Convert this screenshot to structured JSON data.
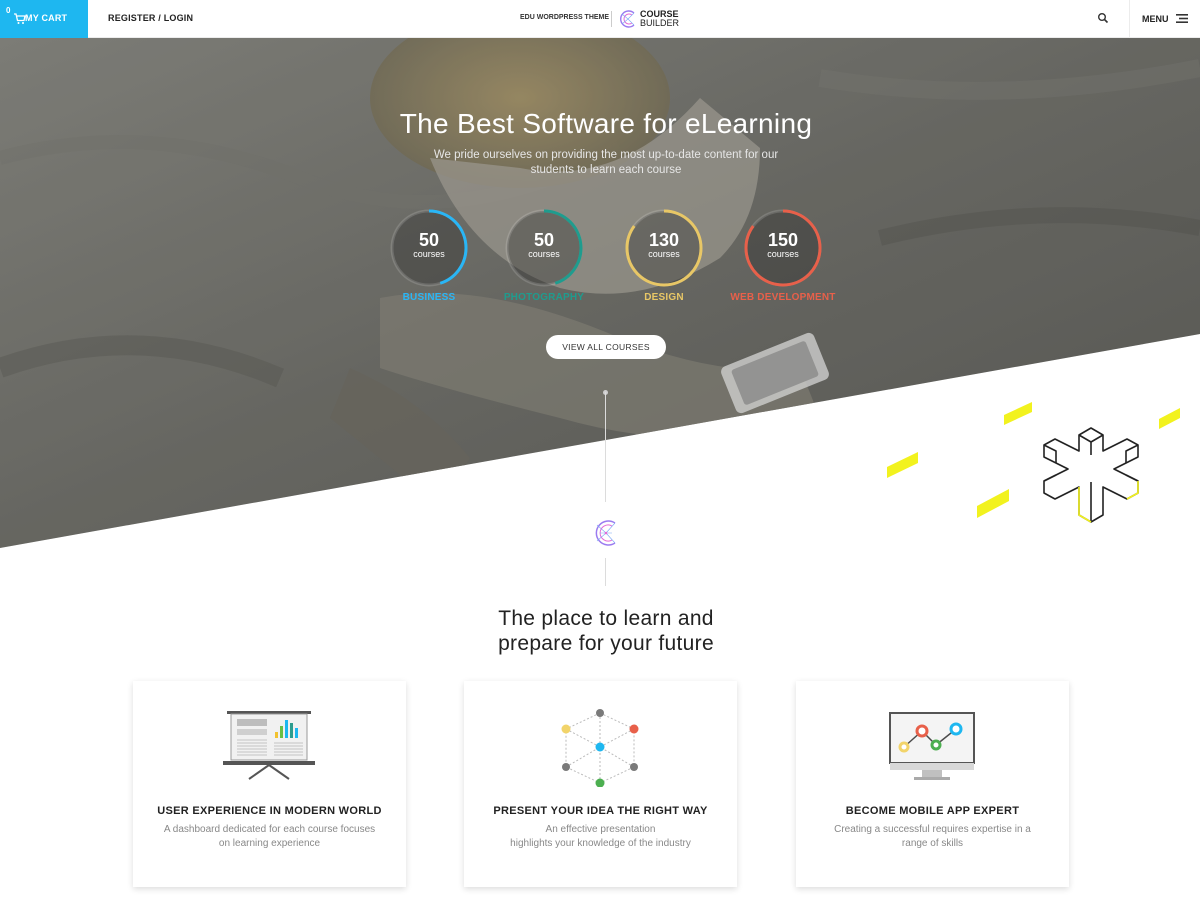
{
  "header": {
    "cart_count": "0",
    "cart_label": "MY CART",
    "login_label": "REGISTER / LOGIN",
    "tagline": "EDU WORDPRESS THEME",
    "logo_line1": "COURSE",
    "logo_line2": "BUILDER",
    "menu_label": "MENU"
  },
  "hero": {
    "title": "The Best Software for eLearning",
    "subtitle": "We pride ourselves on providing the most up-to-date content for our students to learn each course",
    "cta_label": "VIEW ALL COURSES",
    "stats": [
      {
        "number": "50",
        "unit": "courses",
        "label": "BUSINESS",
        "color": "#29b6f6",
        "progress": 0.45
      },
      {
        "number": "50",
        "unit": "courses",
        "label": "PHOTOGRAPHY",
        "color": "#1f9c8e",
        "progress": 0.45
      },
      {
        "number": "130",
        "unit": "courses",
        "label": "DESIGN",
        "color": "#e8c766",
        "progress": 0.85
      },
      {
        "number": "150",
        "unit": "courses",
        "label": "WEB DEVELOPMENT",
        "color": "#e8604a",
        "progress": 0.85
      }
    ]
  },
  "section": {
    "title_line1": "The place to learn and",
    "title_line2": "prepare for your future"
  },
  "features": [
    {
      "icon": "presentation-board-icon",
      "title": "USER EXPERIENCE IN MODERN WORLD",
      "desc_line1": "A dashboard dedicated for each course focuses",
      "desc_line2": "on learning experience"
    },
    {
      "icon": "network-cube-icon",
      "title": "PRESENT YOUR IDEA THE RIGHT WAY",
      "desc_line1": "An effective presentation",
      "desc_line2": "highlights your knowledge of the industry"
    },
    {
      "icon": "monitor-chart-icon",
      "title": "BECOME MOBILE APP EXPERT",
      "desc_line1": "Creating a successful requires expertise in a",
      "desc_line2": "range of skills"
    }
  ],
  "colors": {
    "accent": "#1eb7f0",
    "deco_yellow": "#f2f21e"
  }
}
